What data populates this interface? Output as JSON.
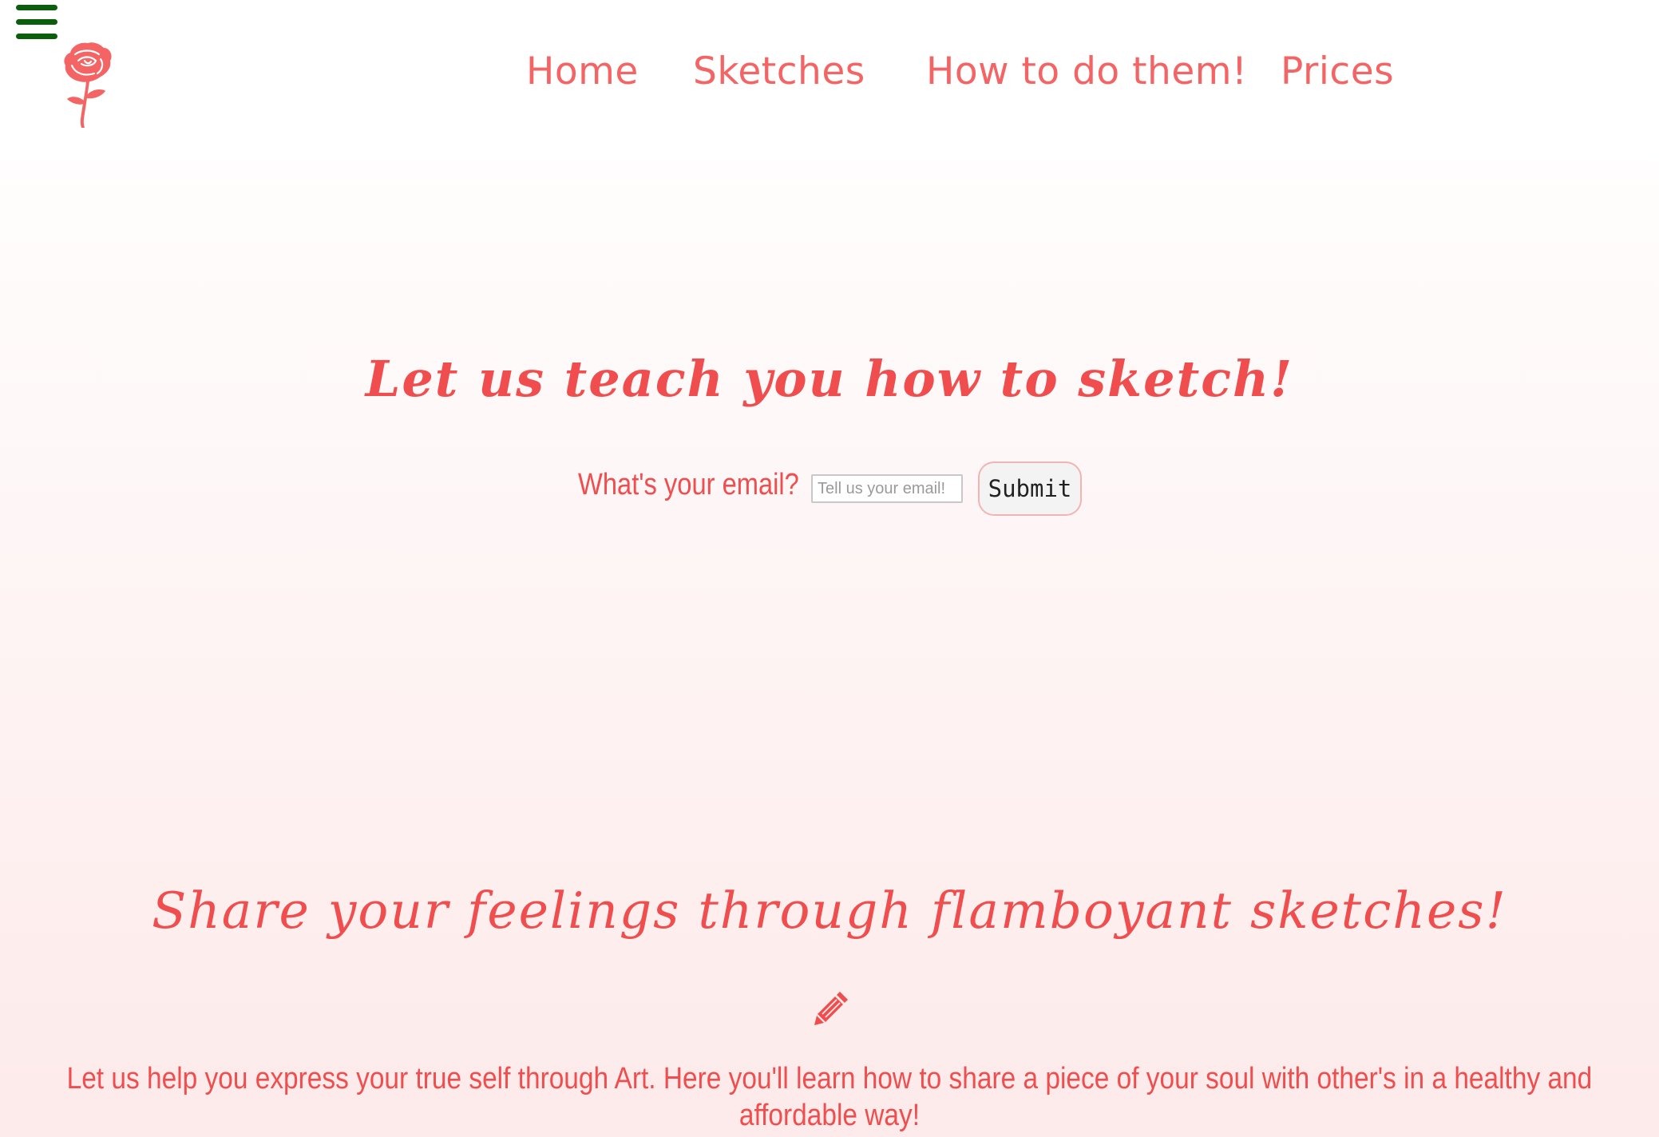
{
  "nav": {
    "items": [
      {
        "label": "Home"
      },
      {
        "label": "Sketches"
      },
      {
        "label": "How to do them!"
      },
      {
        "label": "Prices"
      }
    ]
  },
  "hero": {
    "title": "Let us teach you how to sketch!",
    "email_label": "What's your email?",
    "email_placeholder": "Tell us your email!",
    "email_value": "",
    "submit_label": "Submit"
  },
  "section": {
    "title": "Share your feelings through flamboyant sketches!",
    "icon": "pencil-icon",
    "text": "Let us help you express your true self through Art. Here you'll learn how to share a piece of your soul with other's in a healthy and affordable way!"
  },
  "colors": {
    "accent": "#f46464",
    "menu_icon": "#0b5e0b",
    "background_top": "#fffdfd",
    "background_bottom": "#fdeaea"
  }
}
